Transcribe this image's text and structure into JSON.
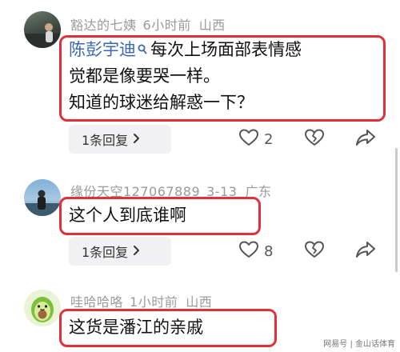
{
  "comments": [
    {
      "username": "豁达的七姨",
      "time": "6小时前",
      "location": "山西",
      "mention": "陈彭宇迪",
      "lines": [
        "每次上场面部表情感",
        "觉都是像要哭一样。",
        "知道的球迷给解惑一下？"
      ],
      "reply_label": "1条回复",
      "like_count": "2"
    },
    {
      "username": "缘份天空127067889",
      "time": "3-13",
      "location": "广东",
      "lines": [
        "这个人到底谁啊"
      ],
      "reply_label": "1条回复",
      "like_count": "8"
    },
    {
      "username": "哇哈哈咯",
      "time": "1小时前",
      "location": "山西",
      "lines": [
        "这货是潘江的亲戚"
      ]
    }
  ],
  "footer": {
    "watermark": "网易号 | 金山话体育"
  },
  "colors": {
    "highlight_border": "#e0303a",
    "mention": "#3a66b8",
    "meta": "#9a9a9a"
  },
  "icons": [
    "mention-search-icon",
    "chevron-right-icon",
    "heart-icon",
    "broken-heart-icon",
    "share-icon"
  ]
}
